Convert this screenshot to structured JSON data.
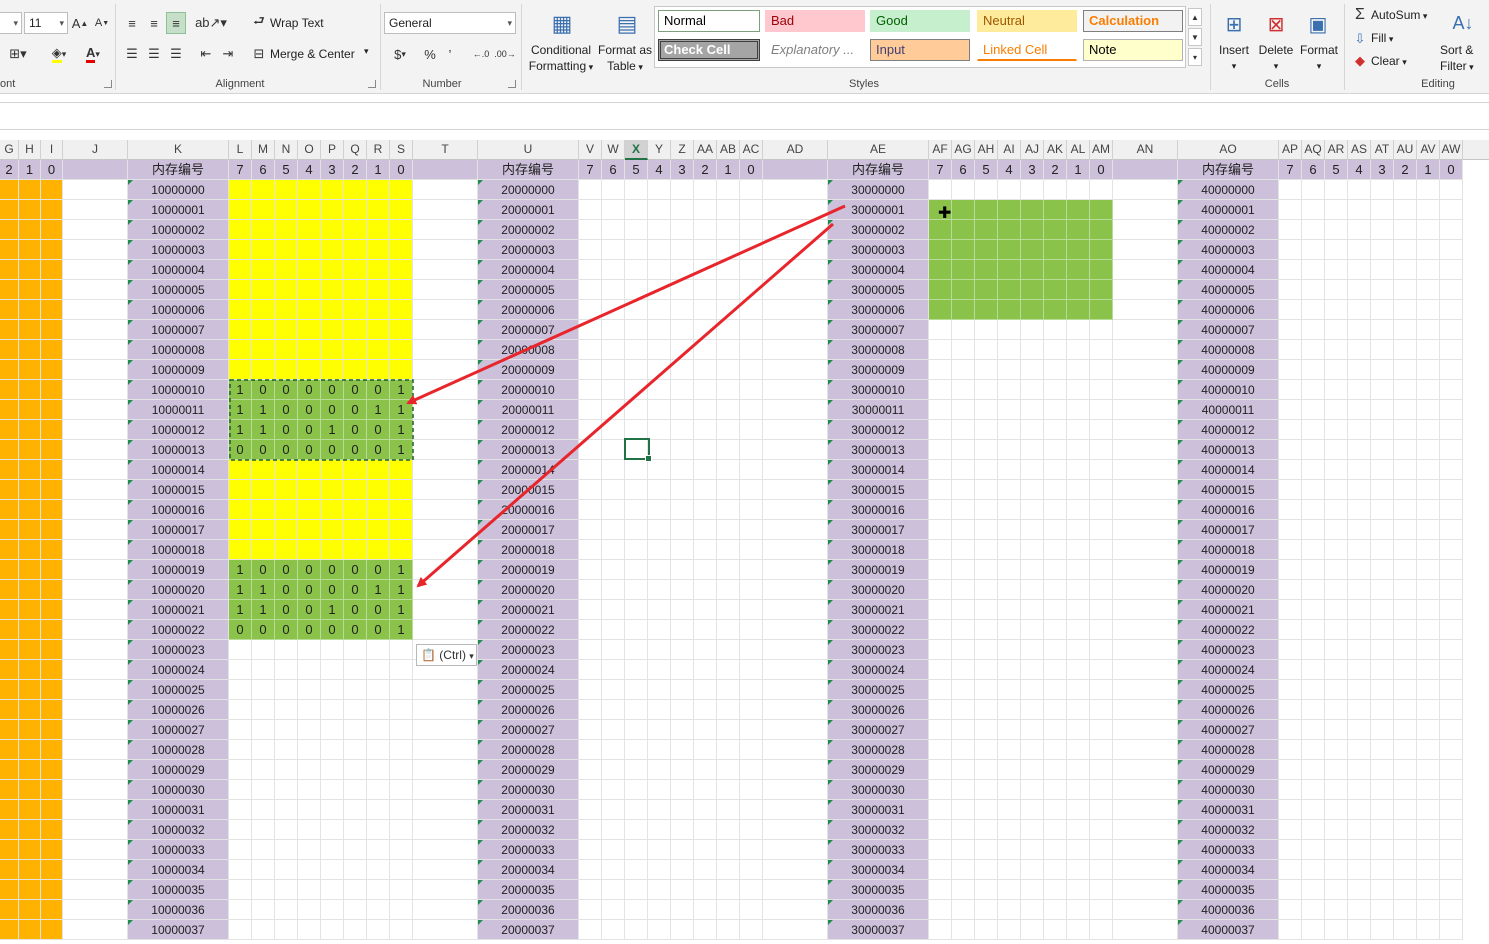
{
  "ribbon": {
    "font_size": "11",
    "wrap_text": "Wrap Text",
    "merge_center": "Merge & Center",
    "number_format": "General",
    "currency": "$",
    "percent": "%",
    "comma": "’",
    "conditional_formatting": [
      "Conditional",
      "Formatting"
    ],
    "format_as_table": [
      "Format as",
      "Table"
    ],
    "styles": [
      {
        "label": "Normal",
        "bg": "#ffffff",
        "fg": "#000000",
        "border": "#7fa07f"
      },
      {
        "label": "Bad",
        "bg": "#ffc7ce",
        "fg": "#9c0006",
        "border": "#ffc7ce"
      },
      {
        "label": "Good",
        "bg": "#c6efce",
        "fg": "#006100",
        "border": "#c6efce"
      },
      {
        "label": "Neutral",
        "bg": "#ffeb9c",
        "fg": "#9c5700",
        "border": "#ffeb9c"
      },
      {
        "label": "Calculation",
        "bg": "#f2f2f2",
        "fg": "#fa7d00",
        "border": "#7f7f7f"
      },
      {
        "label": "Check Cell",
        "bg": "#a5a5a5",
        "fg": "#ffffff",
        "border": "#3f3f3f"
      },
      {
        "label": "Explanatory ...",
        "bg": "#ffffff",
        "fg": "#7f7f7f",
        "border": "#ffffff"
      },
      {
        "label": "Input",
        "bg": "#ffcc99",
        "fg": "#3f3f76",
        "border": "#7f7f7f"
      },
      {
        "label": "Linked Cell",
        "bg": "#ffffff",
        "fg": "#fa7d00",
        "border": "#ffffff"
      },
      {
        "label": "Note",
        "bg": "#ffffcc",
        "fg": "#000000",
        "border": "#b2b2b2"
      }
    ],
    "insert": "Insert",
    "delete": "Delete",
    "format": "Format",
    "autosum": "AutoSum",
    "fill": "Fill",
    "clear": "Clear",
    "sort_filter": [
      "Sort &",
      "Filter"
    ],
    "groups": {
      "font": "ont",
      "alignment": "Alignment",
      "number": "Number",
      "styles": "Styles",
      "cells": "Cells",
      "editing": "Editing"
    }
  },
  "sheet": {
    "header_label": "内存编号",
    "bit_labels": [
      "7",
      "6",
      "5",
      "4",
      "3",
      "2",
      "1",
      "0"
    ],
    "left_bits": [
      "2",
      "1",
      "0"
    ],
    "selected_column": "X",
    "paste_options": "(Ctrl)",
    "prefixes": [
      "1000",
      "2000",
      "3000",
      "4000"
    ],
    "green_bits_top": [
      [
        "1",
        "0",
        "0",
        "0",
        "0",
        "0",
        "0",
        "1"
      ],
      [
        "1",
        "1",
        "0",
        "0",
        "0",
        "0",
        "1",
        "1"
      ],
      [
        "1",
        "1",
        "0",
        "0",
        "1",
        "0",
        "0",
        "1"
      ],
      [
        "0",
        "0",
        "0",
        "0",
        "0",
        "0",
        "0",
        "1"
      ]
    ],
    "green_bits_bottom": [
      [
        "1",
        "0",
        "0",
        "0",
        "0",
        "0",
        "0",
        "1"
      ],
      [
        "1",
        "1",
        "0",
        "0",
        "0",
        "0",
        "1",
        "1"
      ],
      [
        "1",
        "1",
        "0",
        "0",
        "1",
        "0",
        "0",
        "1"
      ],
      [
        "0",
        "0",
        "0",
        "0",
        "0",
        "0",
        "0",
        "1"
      ]
    ],
    "colors": {
      "header_purple": "#ccc0da",
      "yellow": "#ffff00",
      "green": "#8bc34a",
      "orange": "#ffb300",
      "arrow": "#e8252b",
      "excel_green": "#217346"
    }
  }
}
